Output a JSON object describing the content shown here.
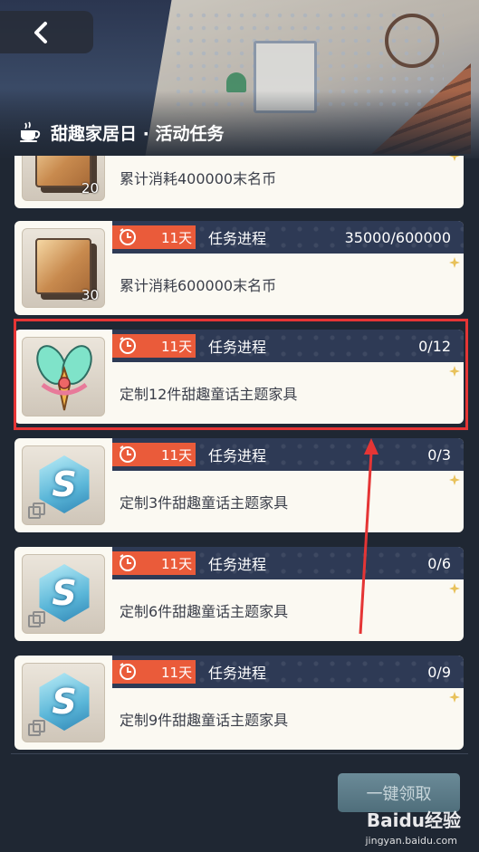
{
  "header": {
    "title": "甜趣家居日 · 活动任务",
    "back_icon": "chevron-left-icon",
    "title_icon": "coffee-cup-icon"
  },
  "tasks": [
    {
      "timer": "",
      "progress_label": "",
      "progress": "",
      "description": "累计消耗400000末名币",
      "reward_icon": "gold-plate-icon",
      "reward_count": "20"
    },
    {
      "timer": "11天",
      "progress_label": "任务进程",
      "progress": "35000/600000",
      "description": "累计消耗600000末名币",
      "reward_icon": "gold-plate-icon",
      "reward_count": "30"
    },
    {
      "timer": "11天",
      "progress_label": "任务进程",
      "progress": "0/12",
      "description": "定制12件甜趣童话主题家具",
      "reward_icon": "fairy-wings-icon",
      "reward_count": ""
    },
    {
      "timer": "11天",
      "progress_label": "任务进程",
      "progress": "0/3",
      "description": "定制3件甜趣童话主题家具",
      "reward_icon": "s-crystal-icon",
      "reward_count": ""
    },
    {
      "timer": "11天",
      "progress_label": "任务进程",
      "progress": "0/6",
      "description": "定制6件甜趣童话主题家具",
      "reward_icon": "s-crystal-icon",
      "reward_count": ""
    },
    {
      "timer": "11天",
      "progress_label": "任务进程",
      "progress": "0/9",
      "description": "定制9件甜趣童话主题家具",
      "reward_icon": "s-crystal-icon",
      "reward_count": ""
    }
  ],
  "footer": {
    "claim_all_label": "一键领取"
  },
  "watermark": {
    "brand": "Baidu经验",
    "url": "jingyan.baidu.com"
  },
  "colors": {
    "timer_badge": "#ea5b3a",
    "task_bar": "#2e3a55",
    "highlight": "#e53535",
    "claim_button": "#5a7a87"
  }
}
